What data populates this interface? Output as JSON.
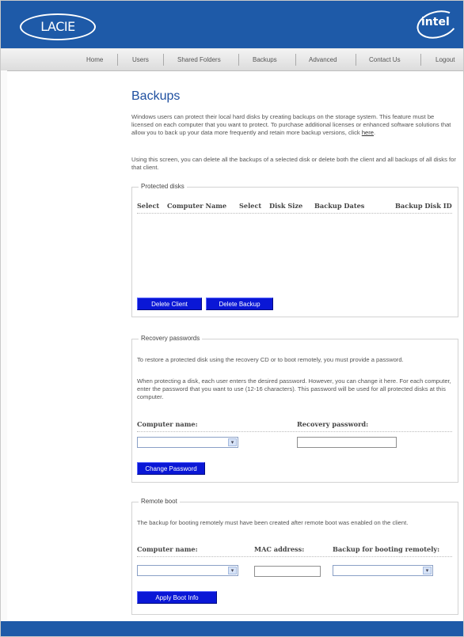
{
  "header": {
    "brand_left": "LACIE",
    "brand_right": "intel",
    "brand_color": "#1e5aa8"
  },
  "nav": {
    "items": [
      "Home",
      "Users",
      "Shared Folders",
      "Backups",
      "Advanced",
      "Contact Us",
      "Logout"
    ]
  },
  "page": {
    "title": "Backups",
    "intro": "Windows users can protect their local hard disks by creating backups on the storage system. This feature must be licensed on each computer that you want to protect. To purchase additional licenses or enhanced software solutions that allow you to back up your data more frequently and retain more backup versions, click ",
    "intro_link": "here",
    "intro_end": ".",
    "delete_info": "Using this screen, you can delete all the backups of a selected disk or delete both the client and all backups of all disks for that client."
  },
  "protected_disks": {
    "legend": "Protected disks",
    "columns": [
      "Select",
      "Computer Name",
      "Select",
      "Disk Size",
      "Backup Dates",
      "Backup Disk ID"
    ],
    "rows": [],
    "delete_client_label": "Delete Client",
    "delete_backup_label": "Delete Backup"
  },
  "recovery": {
    "legend": "Recovery passwords",
    "text1": "To restore a protected disk using the recovery CD or to boot remotely, you must provide a password.",
    "text2": "When protecting a disk, each user enters the desired password. However, you can change it here. For each computer, enter the password that you want to use (12-16 characters). This password will be used for all protected disks at this computer.",
    "computer_label": "Computer name:",
    "password_label": "Recovery password:",
    "computer_value": "",
    "password_value": "",
    "change_label": "Change Password"
  },
  "remote_boot": {
    "legend": "Remote boot",
    "text": "The backup for booting remotely must have been created after remote boot was enabled on the client.",
    "computer_label": "Computer name:",
    "mac_label": "MAC address:",
    "backup_label": "Backup for booting remotely:",
    "computer_value": "",
    "mac_value": "",
    "backup_value": "",
    "apply_label": "Apply Boot Info"
  },
  "icons": {
    "dropdown": "chevron-down-icon"
  }
}
